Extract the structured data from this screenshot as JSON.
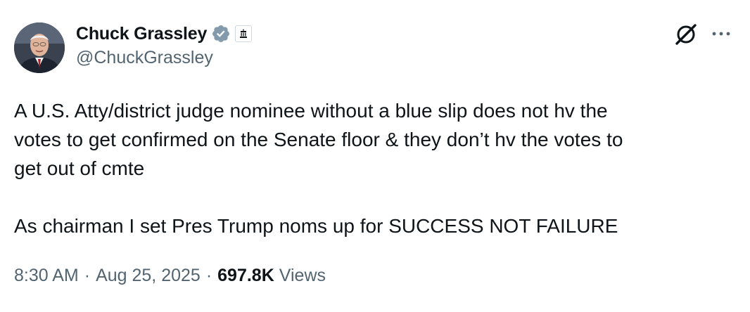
{
  "author": {
    "display_name": "Chuck Grassley",
    "handle": "@ChuckGrassley",
    "verified_badge_icon": "verified-badge-icon",
    "affiliation_icon": "government-building-icon",
    "verified_color": "#829aab"
  },
  "actions": {
    "grok_icon": "grok-icon",
    "more_icon": "more-options-icon"
  },
  "tweet": {
    "text": "A U.S. Atty/district judge nominee without a blue slip does not hv the\nvotes to get confirmed on the Senate floor & they don’t hv the votes to\nget out of cmte\n\nAs chairman I set Pres Trump noms up for SUCCESS NOT FAILURE"
  },
  "meta": {
    "time": "8:30 AM",
    "date": "Aug 25, 2025",
    "separator": "·",
    "views_count": "697.8K",
    "views_label": "Views"
  },
  "colors": {
    "text_primary": "#0f1419",
    "text_secondary": "#536471"
  }
}
